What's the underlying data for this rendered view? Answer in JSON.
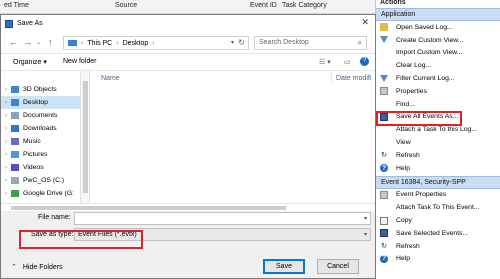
{
  "background": {
    "columns": [
      "ed Time",
      "Source",
      "Event ID",
      "Task Category"
    ]
  },
  "actions_pane": {
    "title": "Actions",
    "section1": "Application",
    "items1": [
      {
        "label": "Open Saved Log...",
        "icon": "folder-icon"
      },
      {
        "label": "Create Custom View...",
        "icon": "filter-icon"
      },
      {
        "label": "Import Custom View...",
        "icon": "blank-icon"
      },
      {
        "label": "Clear Log...",
        "icon": "blank-icon"
      },
      {
        "label": "Filter Current Log...",
        "icon": "filter-icon"
      },
      {
        "label": "Properties",
        "icon": "properties-icon"
      },
      {
        "label": "Find...",
        "icon": "blank-icon"
      },
      {
        "label": "Save All Events As...",
        "icon": "floppy-icon"
      },
      {
        "label": "Attach a Task To this Log...",
        "icon": "blank-icon"
      },
      {
        "label": "View",
        "icon": "blank-icon"
      },
      {
        "label": "Refresh",
        "icon": "refresh-icon"
      },
      {
        "label": "Help",
        "icon": "help-icon"
      }
    ],
    "section2": "Event 16384, Security-SPP",
    "items2": [
      {
        "label": "Event Properties",
        "icon": "properties-icon"
      },
      {
        "label": "Attach Task To This Event...",
        "icon": "blank-icon"
      },
      {
        "label": "Copy",
        "icon": "copy-icon"
      },
      {
        "label": "Save Selected Events...",
        "icon": "floppy-icon"
      },
      {
        "label": "Refresh",
        "icon": "refresh-icon"
      },
      {
        "label": "Help",
        "icon": "help-icon"
      }
    ]
  },
  "dialog": {
    "title": "Save As",
    "path": [
      "This PC",
      "Desktop"
    ],
    "search_placeholder": "Search Desktop",
    "organize_label": "Organize ▾",
    "new_folder_label": "New folder",
    "tree": [
      {
        "label": "3D Objects",
        "icon": "blue"
      },
      {
        "label": "Desktop",
        "icon": "blue",
        "selected": true
      },
      {
        "label": "Documents",
        "icon": "gray"
      },
      {
        "label": "Downloads",
        "icon": "dl"
      },
      {
        "label": "Music",
        "icon": "music"
      },
      {
        "label": "Pictures",
        "icon": "pics"
      },
      {
        "label": "Videos",
        "icon": "videos"
      },
      {
        "label": "PwC_OS (C:)",
        "icon": "drive"
      },
      {
        "label": "Google Drive (G:",
        "icon": "green"
      }
    ],
    "columns": {
      "name": "Name",
      "date": "Date modifi"
    },
    "file_name_label": "File name:",
    "file_name_value": "",
    "save_type_label": "Save as type:",
    "save_type_value": "Event Files (*.evtx)",
    "hide_folders_label": "Hide Folders",
    "save_label": "Save",
    "cancel_label": "Cancel"
  },
  "colors": {
    "highlight": "#e0202a",
    "section": "#c9ddf2",
    "selection": "#cce4f7"
  }
}
